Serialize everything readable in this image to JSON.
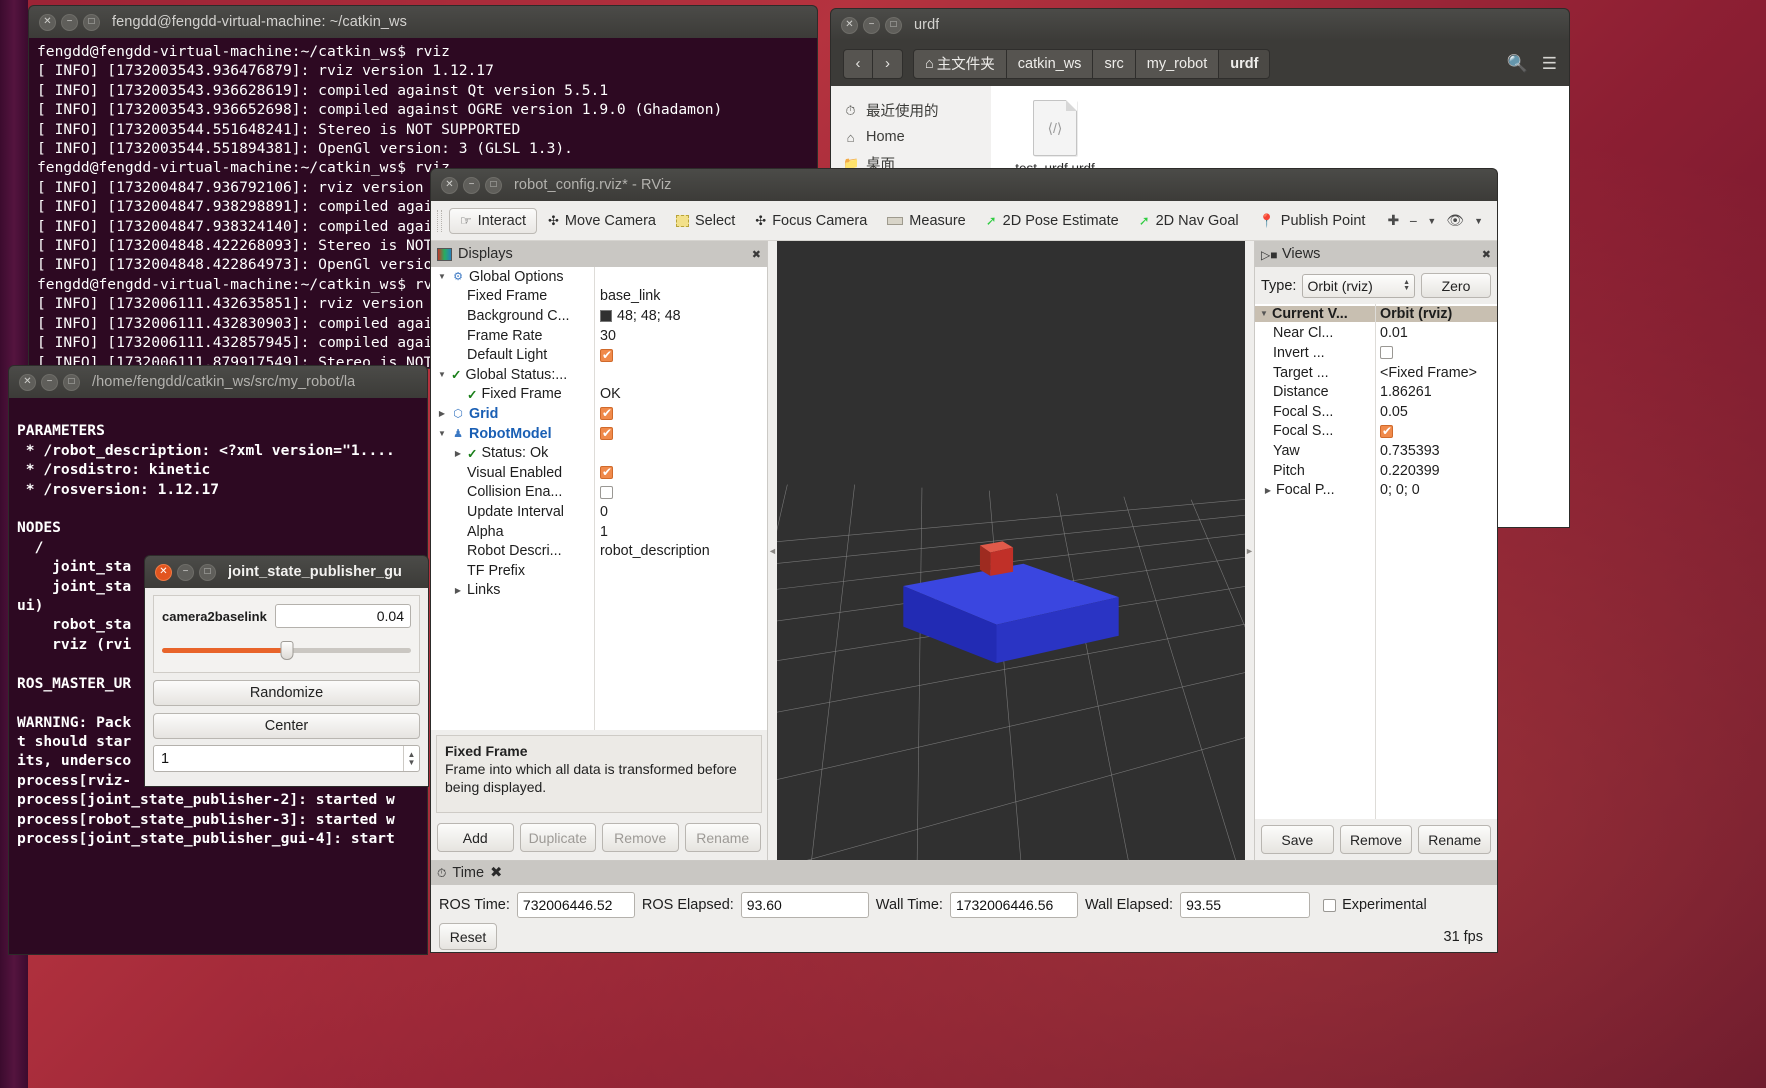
{
  "terminal_main": {
    "title": "fengdd@fengdd-virtual-machine: ~/catkin_ws",
    "lines": "fengdd@fengdd-virtual-machine:~/catkin_ws$ rviz\n[ INFO] [1732003543.936476879]: rviz version 1.12.17\n[ INFO] [1732003543.936628619]: compiled against Qt version 5.5.1\n[ INFO] [1732003543.936652698]: compiled against OGRE version 1.9.0 (Ghadamon)\n[ INFO] [1732003544.551648241]: Stereo is NOT SUPPORTED\n[ INFO] [1732003544.551894381]: OpenGl version: 3 (GLSL 1.3).\nfengdd@fengdd-virtual-machine:~/catkin_ws$ rviz\n[ INFO] [1732004847.936792106]: rviz version 1.12.17\n[ INFO] [1732004847.938298891]: compiled against Qt version 5.5.1\n[ INFO] [1732004847.938324140]: compiled against OGRE version 1.9.0 (Ghadamon)\n[ INFO] [1732004848.422268093]: Stereo is NOT SUPPORTED\n[ INFO] [1732004848.422864973]: OpenGl version: 3 (GLSL 1.3).\nfengdd@fengdd-virtual-machine:~/catkin_ws$ rviz\n[ INFO] [1732006111.432635851]: rviz version 1.12.17\n[ INFO] [1732006111.432830903]: compiled against Qt version 5.5.1\n[ INFO] [1732006111.432857945]: compiled against OGRE version 1.9.0 (Ghadamon)\n[ INFO] [1732006111.879917549]: Stereo is NOT SUPPORTED"
  },
  "terminal_launch": {
    "title": "/home/fengdd/catkin_ws/src/my_robot/la",
    "lines": "\nPARAMETERS\n * /robot_description: <?xml version=\"1....\n * /rosdistro: kinetic\n * /rosversion: 1.12.17\n\nNODES\n  /\n    joint_sta\n    joint_sta\nui)\n    robot_sta\n    rviz (rvi\n\nROS_MASTER_UR\n\nWARNING: Pack\nt should star\nits, undersco\nprocess[rviz-\nprocess[joint_state_publisher-2]: started w\nprocess[robot_state_publisher-3]: started w\nprocess[joint_state_publisher_gui-4]: start"
  },
  "file_manager": {
    "title": "urdf",
    "nav": {
      "back": "‹",
      "forward": "›"
    },
    "breadcrumbs": [
      "主文件夹",
      "catkin_ws",
      "src",
      "my_robot",
      "urdf"
    ],
    "sidebar": [
      {
        "icon": "clock-icon",
        "label": "最近使用的"
      },
      {
        "icon": "home-icon",
        "label": "Home"
      },
      {
        "icon": "folder-icon",
        "label": "桌面"
      }
    ],
    "files": [
      {
        "name": "test_urdf.urdf",
        "icon": "code-file-icon",
        "glyph": "⟨/⟩"
      }
    ],
    "search_icon": "search-icon",
    "menu_icon": "hamburger-icon"
  },
  "rviz": {
    "title": "robot_config.rviz* - RViz",
    "toolbar": [
      {
        "label": "Interact",
        "icon": "hand-cursor-icon",
        "active": true
      },
      {
        "label": "Move Camera",
        "icon": "move-camera-icon",
        "active": false
      },
      {
        "label": "Select",
        "icon": "select-rect-icon",
        "active": false
      },
      {
        "label": "Focus Camera",
        "icon": "focus-camera-icon",
        "active": false
      },
      {
        "label": "Measure",
        "icon": "ruler-icon",
        "active": false
      },
      {
        "label": "2D Pose Estimate",
        "icon": "pose-arrow-icon",
        "active": false
      },
      {
        "label": "2D Nav Goal",
        "icon": "nav-arrow-icon",
        "active": false
      },
      {
        "label": "Publish Point",
        "icon": "map-pin-icon",
        "active": false
      }
    ],
    "displays": {
      "header": "Displays",
      "header_icon": "displays-icon",
      "rows": [
        {
          "indent": 0,
          "arrow": "down",
          "icon": "gear-icon",
          "name": "Global Options",
          "value": "",
          "value_type": "none",
          "bold": false
        },
        {
          "indent": 1,
          "arrow": "none",
          "icon": "",
          "name": "Fixed Frame",
          "value": "base_link",
          "value_type": "text",
          "bold": false
        },
        {
          "indent": 1,
          "arrow": "none",
          "icon": "",
          "name": "Background C...",
          "value": "48; 48; 48",
          "value_type": "color",
          "bold": false
        },
        {
          "indent": 1,
          "arrow": "none",
          "icon": "",
          "name": "Frame Rate",
          "value": "30",
          "value_type": "text",
          "bold": false
        },
        {
          "indent": 1,
          "arrow": "none",
          "icon": "",
          "name": "Default Light",
          "value": "",
          "value_type": "check-on",
          "bold": false
        },
        {
          "indent": 0,
          "arrow": "down",
          "icon": "tick-icon",
          "name": "Global Status:...",
          "value": "",
          "value_type": "none",
          "bold": false
        },
        {
          "indent": 1,
          "arrow": "none",
          "icon": "tick-icon",
          "name": "Fixed Frame",
          "value": "OK",
          "value_type": "text",
          "bold": false
        },
        {
          "indent": 0,
          "arrow": "right",
          "icon": "grid-icon",
          "name": "Grid",
          "value": "",
          "value_type": "check-on",
          "bold": true
        },
        {
          "indent": 0,
          "arrow": "down",
          "icon": "robot-icon",
          "name": "RobotModel",
          "value": "",
          "value_type": "check-on",
          "bold": true
        },
        {
          "indent": 1,
          "arrow": "right",
          "icon": "tick-icon",
          "name": "Status: Ok",
          "value": "",
          "value_type": "none",
          "bold": false
        },
        {
          "indent": 1,
          "arrow": "none",
          "icon": "",
          "name": "Visual Enabled",
          "value": "",
          "value_type": "check-on",
          "bold": false
        },
        {
          "indent": 1,
          "arrow": "none",
          "icon": "",
          "name": "Collision Ena...",
          "value": "",
          "value_type": "check-off",
          "bold": false
        },
        {
          "indent": 1,
          "arrow": "none",
          "icon": "",
          "name": "Update Interval",
          "value": "0",
          "value_type": "text",
          "bold": false
        },
        {
          "indent": 1,
          "arrow": "none",
          "icon": "",
          "name": "Alpha",
          "value": "1",
          "value_type": "text",
          "bold": false
        },
        {
          "indent": 1,
          "arrow": "none",
          "icon": "",
          "name": "Robot Descri...",
          "value": "robot_description",
          "value_type": "text",
          "bold": false
        },
        {
          "indent": 1,
          "arrow": "none",
          "icon": "",
          "name": "TF Prefix",
          "value": "",
          "value_type": "text",
          "bold": false
        },
        {
          "indent": 1,
          "arrow": "right",
          "icon": "",
          "name": "Links",
          "value": "",
          "value_type": "none",
          "bold": false
        }
      ],
      "description": {
        "title": "Fixed Frame",
        "body": "Frame into which all data is transformed before being displayed."
      },
      "buttons": [
        {
          "label": "Add",
          "disabled": false
        },
        {
          "label": "Duplicate",
          "disabled": true
        },
        {
          "label": "Remove",
          "disabled": true
        },
        {
          "label": "Rename",
          "disabled": true
        }
      ]
    },
    "views": {
      "header": "Views",
      "header_icon": "views-camera-icon",
      "type_label": "Type:",
      "type_value": "Orbit (rviz)",
      "zero_button": "Zero",
      "columns": [
        "Current V...",
        "Orbit (rviz)"
      ],
      "rows": [
        {
          "name": "Near Cl...",
          "value": "0.01",
          "value_type": "text"
        },
        {
          "name": "Invert ...",
          "value": "",
          "value_type": "check-off"
        },
        {
          "name": "Target ...",
          "value": "<Fixed Frame>",
          "value_type": "text"
        },
        {
          "name": "Distance",
          "value": "1.86261",
          "value_type": "text"
        },
        {
          "name": "Focal S...",
          "value": "0.05",
          "value_type": "text"
        },
        {
          "name": "Focal S...",
          "value": "",
          "value_type": "check-on"
        },
        {
          "name": "Yaw",
          "value": "0.735393",
          "value_type": "text"
        },
        {
          "name": "Pitch",
          "value": "0.220399",
          "value_type": "text"
        },
        {
          "name": "Focal P...",
          "value": "0; 0; 0",
          "value_type": "text",
          "arrow": "right"
        }
      ],
      "buttons": [
        "Save",
        "Remove",
        "Rename"
      ]
    },
    "time": {
      "header": "Time",
      "header_icon": "clock-icon",
      "fields": [
        {
          "label": "ROS Time:",
          "value": "732006446.52"
        },
        {
          "label": "ROS Elapsed:",
          "value": "93.60"
        },
        {
          "label": "Wall Time:",
          "value": "1732006446.56"
        },
        {
          "label": "Wall Elapsed:",
          "value": "93.55"
        }
      ],
      "experimental_label": "Experimental",
      "experimental_checked": false,
      "reset_button": "Reset",
      "fps": "31 fps"
    }
  },
  "joint_state_publisher": {
    "title": "joint_state_publisher_gu",
    "joint_name": "camera2baselink",
    "joint_value": "0.04",
    "slider_percent": 50,
    "randomize_button": "Randomize",
    "center_button": "Center",
    "spin_value": "1"
  },
  "colors": {
    "terminal_bg": "#2d0922",
    "prompt_green": "#8ae234",
    "path_blue": "#729fcf",
    "accent_orange": "#e8642a",
    "viewport_bg": "#303030",
    "robot_body": "#2b35c8",
    "robot_camera": "#c03028"
  }
}
